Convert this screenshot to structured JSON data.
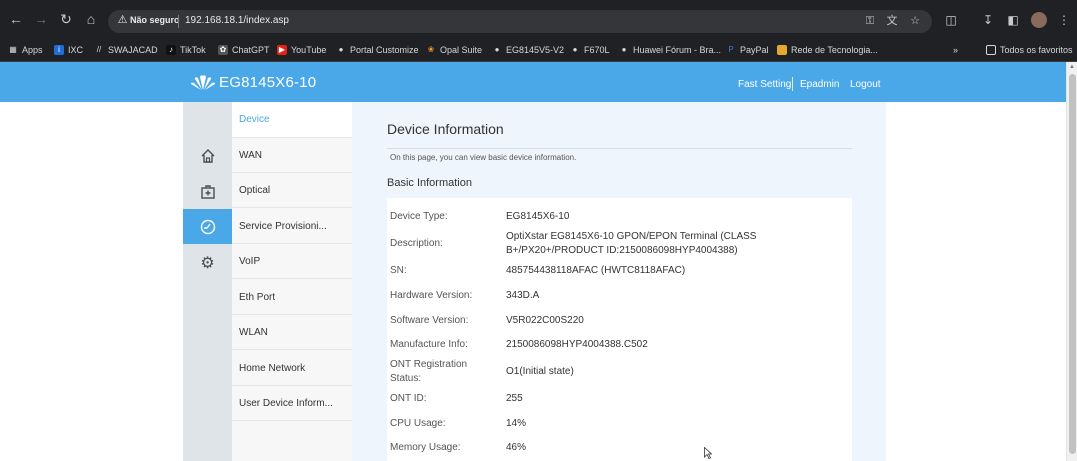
{
  "browser": {
    "security_label": "Não seguro",
    "url": "192.168.18.1/index.asp",
    "bookmarks": [
      "Apps",
      "IXC",
      "SWAJACAD",
      "TikTok",
      "ChatGPT",
      "YouTube",
      "Portal Customize",
      "Opal Suite",
      "EG8145V5-V2",
      "F670L",
      "Huawei Fórum - Bra...",
      "PayPal",
      "Rede de Tecnologia..."
    ],
    "all_bookmarks": "Todos os favoritos"
  },
  "header": {
    "model": "EG8145X6-10",
    "fast_setting": "Fast Setting",
    "user": "Epadmin",
    "logout": "Logout"
  },
  "menu": {
    "items": [
      "Device",
      "WAN",
      "Optical",
      "Service Provisioni...",
      "VoIP",
      "Eth Port",
      "WLAN",
      "Home Network",
      "User Device Inform..."
    ]
  },
  "content": {
    "title": "Device Information",
    "description": "On this page, you can view basic device information.",
    "section_title": "Basic Information",
    "rows": [
      {
        "label": "Device Type:",
        "value": "EG8145X6-10"
      },
      {
        "label": "Description:",
        "value": "OptiXstar EG8145X6-10 GPON/EPON Terminal (CLASS B+/PX20+/PRODUCT ID:2150086098HYP4004388)"
      },
      {
        "label": "SN:",
        "value": "485754438118AFAC (HWTC8118AFAC)"
      },
      {
        "label": "Hardware Version:",
        "value": "343D.A"
      },
      {
        "label": "Software Version:",
        "value": "V5R022C00S220"
      },
      {
        "label": "Manufacture Info:",
        "value": "2150086098HYP4004388.C502"
      },
      {
        "label": "ONT Registration Status:",
        "value": "O1(Initial state)"
      },
      {
        "label": "ONT ID:",
        "value": "255"
      },
      {
        "label": "CPU Usage:",
        "value": "14%"
      },
      {
        "label": "Memory Usage:",
        "value": "46%"
      }
    ]
  },
  "colors": {
    "accent": "#4aa8e9",
    "chrome": "#202124"
  },
  "icons": [
    "back-icon",
    "forward-icon",
    "reload-icon",
    "home-icon",
    "warning-icon",
    "key-icon",
    "translate-icon",
    "star-icon",
    "extensions-icon",
    "download-icon",
    "sidebar-icon",
    "more-icon",
    "huawei-logo",
    "house-icon",
    "medical-box-icon",
    "gauge-icon",
    "gear-icon",
    "folder-icon"
  ]
}
